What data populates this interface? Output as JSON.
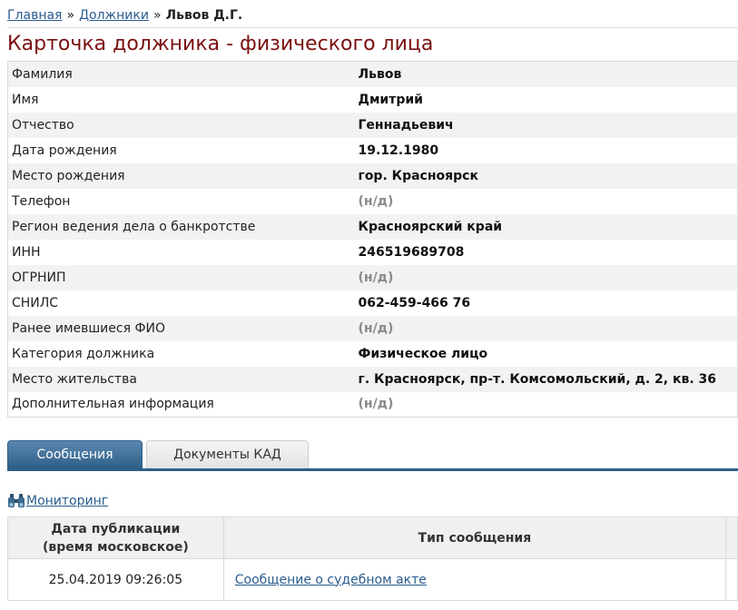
{
  "breadcrumb": {
    "home": "Главная",
    "separator": "»",
    "debtors": "Должники",
    "current": "Львов Д.Г."
  },
  "page_title": "Карточка должника - физического лица",
  "info": {
    "rows": [
      {
        "label": "Фамилия",
        "value": "Львов",
        "na": false
      },
      {
        "label": "Имя",
        "value": "Дмитрий",
        "na": false
      },
      {
        "label": "Отчество",
        "value": "Геннадьевич",
        "na": false
      },
      {
        "label": "Дата рождения",
        "value": "19.12.1980",
        "na": false
      },
      {
        "label": "Место рождения",
        "value": "гор. Красноярск",
        "na": false
      },
      {
        "label": "Телефон",
        "value": "(н/д)",
        "na": true
      },
      {
        "label": "Регион ведения дела о банкротстве",
        "value": "Красноярский край",
        "na": false
      },
      {
        "label": "ИНН",
        "value": "246519689708",
        "na": false
      },
      {
        "label": "ОГРНИП",
        "value": "(н/д)",
        "na": true
      },
      {
        "label": "СНИЛС",
        "value": "062-459-466 76",
        "na": false
      },
      {
        "label": "Ранее имевшиеся ФИО",
        "value": "(н/д)",
        "na": true
      },
      {
        "label": "Категория должника",
        "value": "Физическое лицо",
        "na": false
      },
      {
        "label": "Место жительства",
        "value": "г. Красноярск, пр-т. Комсомольский, д. 2, кв. 36",
        "na": false
      },
      {
        "label": "Дополнительная информация",
        "value": "(н/д)",
        "na": true
      }
    ]
  },
  "tabs": [
    {
      "label": "Сообщения",
      "active": true
    },
    {
      "label": "Документы КАД",
      "active": false
    }
  ],
  "monitoring": {
    "icon": "binoculars-icon",
    "label": "Мониторинг"
  },
  "messages": {
    "headers": {
      "date_line1": "Дата публикации",
      "date_line2": "(время московское)",
      "type": "Тип сообщения"
    },
    "rows": [
      {
        "date": "25.04.2019 09:26:05",
        "type": "Сообщение о судебном акте"
      }
    ]
  },
  "colors": {
    "title": "#7a1010",
    "link": "#2a5c8f",
    "tab_active": "#2f5f88",
    "na_value": "#8a8a8a"
  }
}
